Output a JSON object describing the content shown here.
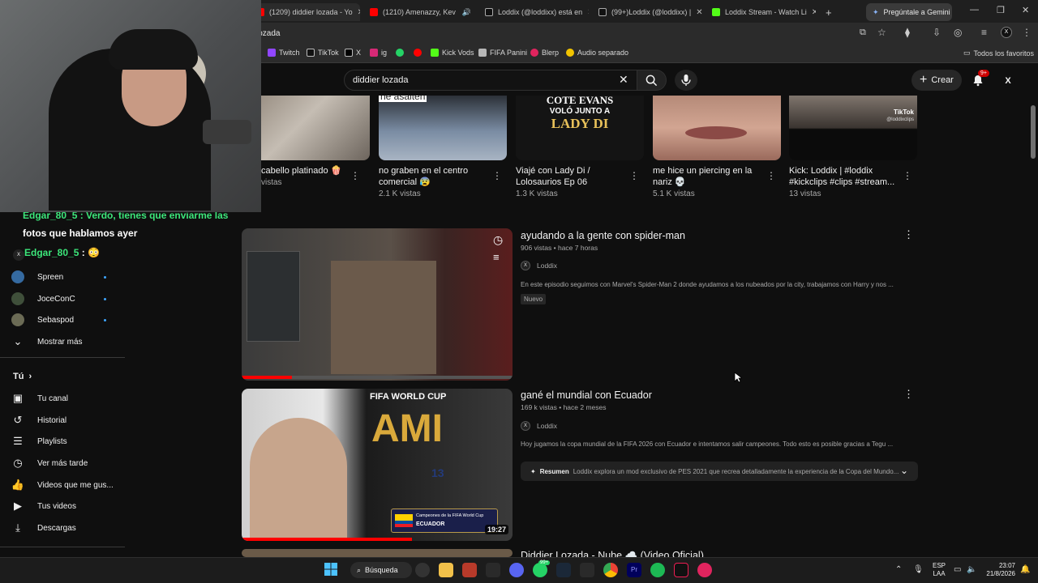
{
  "browser": {
    "tabs": [
      {
        "title": "(1209) diddier lozada - Yo",
        "color": "#ff0000"
      },
      {
        "title": "(1210) Amenazzy, Kev",
        "color": "#ff0000"
      },
      {
        "title": "Loddix (@loddixx) está en",
        "color": "#111111"
      },
      {
        "title": "(99+)Loddix (@loddixx) |",
        "color": "#111111"
      },
      {
        "title": "Loddix Stream - Watch Li",
        "color": "#53fc18"
      }
    ],
    "gemini_label": "Pregúntale a Gemini",
    "url": "lozada",
    "bookmarks": [
      "Twitch",
      "TikTok",
      "X",
      "ig",
      "Kick Vods",
      "FIFA Panini",
      "Blerp",
      "Audio separado"
    ],
    "all_bookmarks": "Todos los favoritos"
  },
  "youtube": {
    "search_value": "diddier lozada",
    "create_label": "Crear",
    "notif_badge": "9+",
    "shorts": [
      {
        "title": "cabello platinado 🍿",
        "views": "vistas"
      },
      {
        "title": "no graben en el centro comercial 😰",
        "views": "2.1 K vistas",
        "overlay": "ne asalten"
      },
      {
        "title": "Viajé con Lady Di / Lolosaurios Ep 06",
        "views": "1.3 K vistas",
        "overlay1": "COTE EVANS",
        "overlay2": "VOLÓ JUNTO A",
        "overlay3": "LADY DI"
      },
      {
        "title": "me hice un piercing en la nariz 💀",
        "views": "5.1 K vistas"
      },
      {
        "title": "Kick: Loddix | #loddix #kickclips #clips #stream...",
        "views": "13 vistas",
        "overlay": "TikTok",
        "overlay2": "@loddixclips"
      }
    ],
    "chat": {
      "line1": "Edgar_80_5 : Verdo, tienes que enviarme las",
      "line2": "fotos que hablamos ayer",
      "line3_user": "Edgar_80_5",
      "line3_rest": " : 😳"
    },
    "sidebar": {
      "subs": [
        {
          "name": "Spreen"
        },
        {
          "name": "JoceConC"
        },
        {
          "name": "Sebaspod"
        }
      ],
      "show_more": "Mostrar más",
      "you_heading": "Tú",
      "you_items": [
        "Tu canal",
        "Historial",
        "Playlists",
        "Ver más tarde",
        "Videos que me gus...",
        "Tus videos",
        "Descargas"
      ]
    },
    "results": [
      {
        "title": "ayudando a la gente con spider-man",
        "meta": "906 vistas • hace 7 horas",
        "channel": "Loddix",
        "desc": "En este episodio seguimos con Marvel's Spider-Man 2 donde ayudamos a los nubeados por la city, trabajamos con Harry y nos ...",
        "badge": "Nuevo"
      },
      {
        "title": "gané el mundial con Ecuador",
        "meta": "169 k vistas • hace 2 meses",
        "channel": "Loddix",
        "desc": "Hoy jugamos la copa mundial de la FIFA 2026 con Ecuador e intentamos salir campeones. Todo esto es posible gracias a Tegu ...",
        "summary_label": "Resumen",
        "summary_text": "Loddix explora un mod exclusivo de PES 2021 que recrea detalladamente la experiencia de la Copa del Mundo...",
        "duration": "19:27",
        "thumb_top": "FIFA WORLD CUP",
        "thumb_big": "AMI",
        "thumb_caption1": "Campeones de la FIFA World Cup",
        "thumb_caption2": "ECUADOR",
        "jersey": "13"
      },
      {
        "title": "Diddier Lozada - Nube ☁️ (Video Oficial)"
      }
    ]
  },
  "taskbar": {
    "search_label": "Búsqueda",
    "lang1": "ESP",
    "lang2": "LAA",
    "time": "23:07",
    "date": "21/8/2026",
    "badge_a": "99+"
  }
}
